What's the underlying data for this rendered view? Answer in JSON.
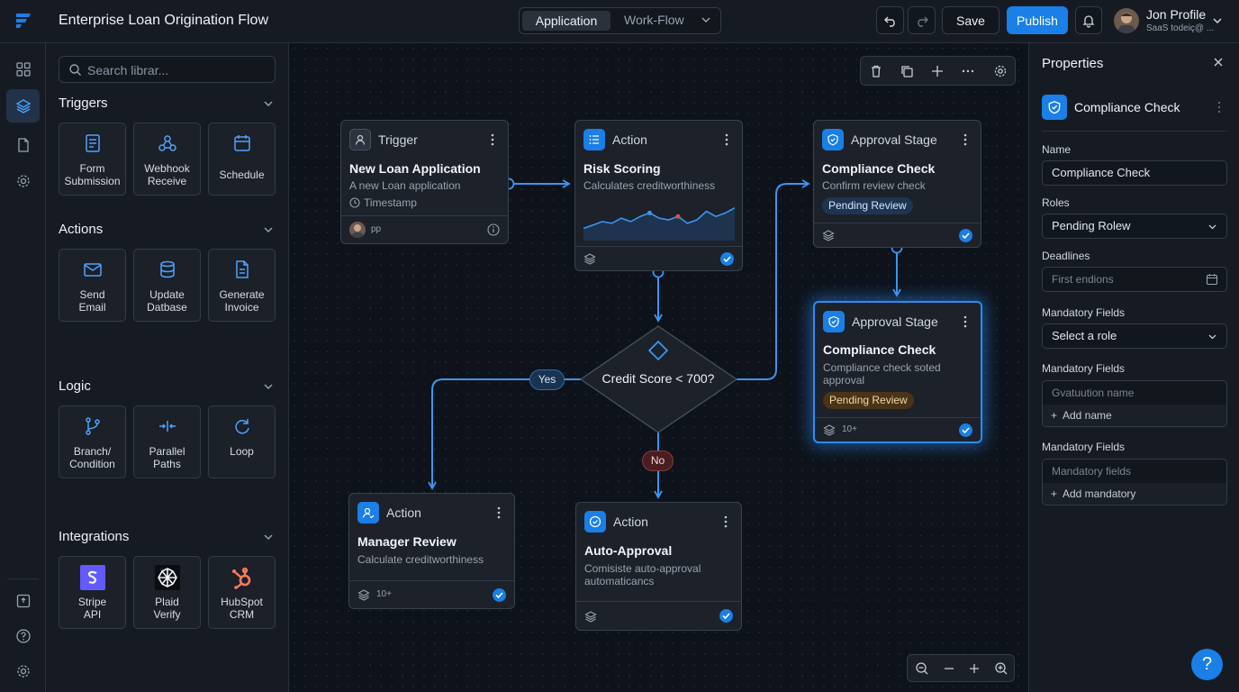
{
  "header": {
    "title": "Enterprise Loan Origination Flow",
    "tabs": [
      "Application",
      "Work-Flow"
    ],
    "save_label": "Save",
    "publish_label": "Publish",
    "profile_name": "Jon Profile",
    "profile_sub": "SaaS todeiç@ ..."
  },
  "library": {
    "search_placeholder": "Search librar...",
    "sections": {
      "triggers": "Triggers",
      "actions": "Actions",
      "logic": "Logic",
      "integrations": "Integrations"
    },
    "triggers": [
      {
        "l1": "Form",
        "l2": "Submission",
        "icon": "form-icon"
      },
      {
        "l1": "Webhook",
        "l2": "Receive",
        "icon": "webhook-icon"
      },
      {
        "l1": "Schedule",
        "l2": "",
        "icon": "calendar-icon"
      }
    ],
    "actions": [
      {
        "l1": "Send",
        "l2": "Email",
        "icon": "mail-icon"
      },
      {
        "l1": "Update",
        "l2": "Datbase",
        "icon": "database-icon"
      },
      {
        "l1": "Generate",
        "l2": "Invoice",
        "icon": "document-icon"
      }
    ],
    "logic": [
      {
        "l1": "Branch/",
        "l2": "Condition",
        "icon": "branch-icon"
      },
      {
        "l1": "Parallel",
        "l2": "Paths",
        "icon": "parallel-icon"
      },
      {
        "l1": "Loop",
        "l2": "",
        "icon": "loop-icon"
      }
    ],
    "integrations": [
      {
        "l1": "Stripe",
        "l2": "API",
        "icon": "stripe-icon"
      },
      {
        "l1": "Plaid",
        "l2": "Verify",
        "icon": "plaid-icon"
      },
      {
        "l1": "HubSpot",
        "l2": "CRM",
        "icon": "hubspot-icon"
      }
    ]
  },
  "nodes": {
    "trigger": {
      "type": "Trigger",
      "title": "New Loan Application",
      "desc": "A new Loan application",
      "meta": "Timestamp",
      "foot": "pp"
    },
    "risk": {
      "type": "Action",
      "title": "Risk Scoring",
      "desc": "Calculates creditworthiness"
    },
    "approval1": {
      "type": "Approval Stage",
      "title": "Compliance Check",
      "desc": "Confirm review check",
      "badge": "Pending Review"
    },
    "approval2": {
      "type": "Approval Stage",
      "title": "Compliance Check",
      "desc1": "Compliance check soted",
      "desc2": "approval",
      "badge": "Pending Review",
      "foot": "10+"
    },
    "decision": {
      "label": "Credit Score < 700?",
      "yes": "Yes",
      "no": "No"
    },
    "manager": {
      "type": "Action",
      "title": "Manager Review",
      "desc": "Calculate creditworthiness",
      "foot": "10+"
    },
    "auto": {
      "type": "Action",
      "title": "Auto-Approval",
      "desc1": "Comisiste auto-approval",
      "desc2": "automaticancs"
    }
  },
  "risk_sparkline": [
    0.25,
    0.35,
    0.45,
    0.4,
    0.55,
    0.45,
    0.6,
    0.7,
    0.55,
    0.5,
    0.6,
    0.4,
    0.5,
    0.75,
    0.6,
    0.7,
    0.85
  ],
  "properties": {
    "title": "Properties",
    "node_title": "Compliance Check",
    "name_label": "Name",
    "name_value": "Compliance Check",
    "roles_label": "Roles",
    "roles_value": "Pending Rolew",
    "deadlines_label": "Deadlines",
    "deadlines_placeholder": "First endions",
    "mf1_label": "Mandatory Fields",
    "mf1_value": "Select a role",
    "mf2_label": "Mandatory Fields",
    "mf2_placeholder": "Gvatuution name",
    "mf2_add": "Add name",
    "mf3_label": "Mandatory Fields",
    "mf3_placeholder": "Mandatory fields",
    "mf3_add": "Add mandatory"
  },
  "colors": {
    "accent": "#1a7fe6",
    "selected_glow": "#2b8df5",
    "no_pill": "#4a1e21"
  },
  "help_label": "?"
}
